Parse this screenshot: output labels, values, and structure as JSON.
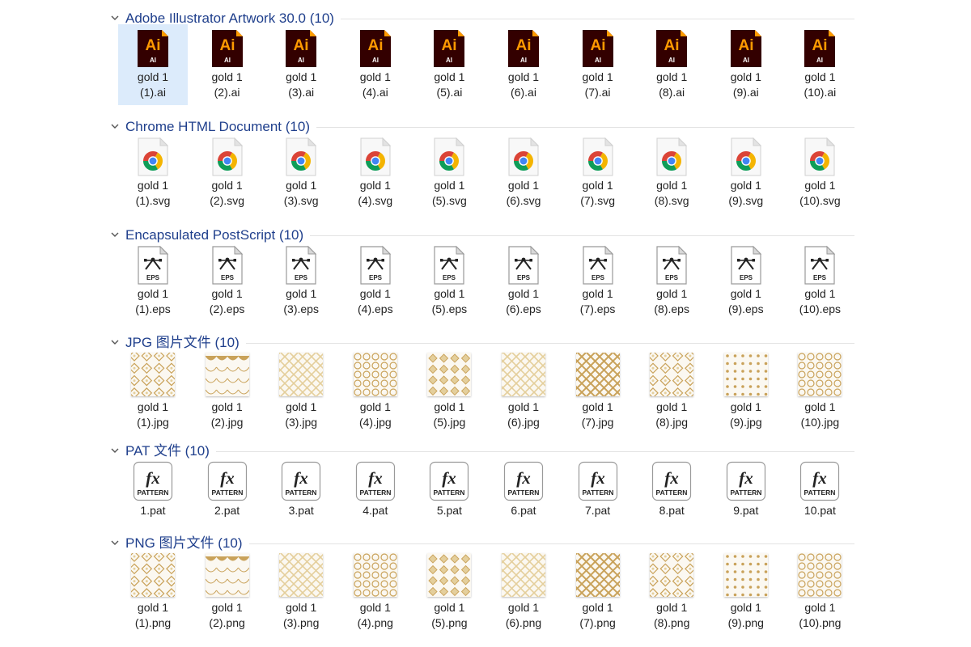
{
  "colors": {
    "group_title": "#1f3f8c",
    "selection": "#dcebfb",
    "ai_bg": "#330000",
    "ai_orange": "#ff9a00",
    "gold": "#c9a25a"
  },
  "groups": [
    {
      "id": "ai",
      "title": "Adobe Illustrator Artwork 30.0 (10)",
      "icon": "illustrator-file-icon",
      "items": [
        {
          "line1": "gold 1",
          "line2": "(1).ai",
          "selected": true
        },
        {
          "line1": "gold 1",
          "line2": "(2).ai"
        },
        {
          "line1": "gold 1",
          "line2": "(3).ai"
        },
        {
          "line1": "gold 1",
          "line2": "(4).ai"
        },
        {
          "line1": "gold 1",
          "line2": "(5).ai"
        },
        {
          "line1": "gold 1",
          "line2": "(6).ai"
        },
        {
          "line1": "gold 1",
          "line2": "(7).ai"
        },
        {
          "line1": "gold 1",
          "line2": "(8).ai"
        },
        {
          "line1": "gold 1",
          "line2": "(9).ai"
        },
        {
          "line1": "gold 1",
          "line2": "(10).ai"
        }
      ]
    },
    {
      "id": "svg",
      "title": "Chrome HTML Document (10)",
      "icon": "chrome-document-icon",
      "items": [
        {
          "line1": "gold 1",
          "line2": "(1).svg"
        },
        {
          "line1": "gold 1",
          "line2": "(2).svg"
        },
        {
          "line1": "gold 1",
          "line2": "(3).svg"
        },
        {
          "line1": "gold 1",
          "line2": "(4).svg"
        },
        {
          "line1": "gold 1",
          "line2": "(5).svg"
        },
        {
          "line1": "gold 1",
          "line2": "(6).svg"
        },
        {
          "line1": "gold 1",
          "line2": "(7).svg"
        },
        {
          "line1": "gold 1",
          "line2": "(8).svg"
        },
        {
          "line1": "gold 1",
          "line2": "(9).svg"
        },
        {
          "line1": "gold 1",
          "line2": "(10).svg"
        }
      ]
    },
    {
      "id": "eps",
      "title": "Encapsulated PostScript (10)",
      "icon": "eps-file-icon",
      "icon_label": "EPS",
      "items": [
        {
          "line1": "gold 1",
          "line2": "(1).eps"
        },
        {
          "line1": "gold 1",
          "line2": "(2).eps"
        },
        {
          "line1": "gold 1",
          "line2": "(3).eps"
        },
        {
          "line1": "gold 1",
          "line2": "(4).eps"
        },
        {
          "line1": "gold 1",
          "line2": "(5).eps"
        },
        {
          "line1": "gold 1",
          "line2": "(6).eps"
        },
        {
          "line1": "gold 1",
          "line2": "(7).eps"
        },
        {
          "line1": "gold 1",
          "line2": "(8).eps"
        },
        {
          "line1": "gold 1",
          "line2": "(9).eps"
        },
        {
          "line1": "gold 1",
          "line2": "(10).eps"
        }
      ]
    },
    {
      "id": "jpg",
      "title": "JPG 图片文件 (10)",
      "icon": "pattern-thumbnail",
      "items": [
        {
          "line1": "gold 1",
          "line2": "(1).jpg"
        },
        {
          "line1": "gold 1",
          "line2": "(2).jpg"
        },
        {
          "line1": "gold 1",
          "line2": "(3).jpg"
        },
        {
          "line1": "gold 1",
          "line2": "(4).jpg"
        },
        {
          "line1": "gold 1",
          "line2": "(5).jpg"
        },
        {
          "line1": "gold 1",
          "line2": "(6).jpg"
        },
        {
          "line1": "gold 1",
          "line2": "(7).jpg"
        },
        {
          "line1": "gold 1",
          "line2": "(8).jpg"
        },
        {
          "line1": "gold 1",
          "line2": "(9).jpg"
        },
        {
          "line1": "gold 1",
          "line2": "(10).jpg"
        }
      ]
    },
    {
      "id": "pat",
      "title": "PAT 文件 (10)",
      "icon": "pattern-file-icon",
      "icon_label": "PATTERN",
      "icon_glyph": "fx",
      "items": [
        {
          "line1": "1.pat"
        },
        {
          "line1": "2.pat"
        },
        {
          "line1": "3.pat"
        },
        {
          "line1": "4.pat"
        },
        {
          "line1": "5.pat"
        },
        {
          "line1": "6.pat"
        },
        {
          "line1": "7.pat"
        },
        {
          "line1": "8.pat"
        },
        {
          "line1": "9.pat"
        },
        {
          "line1": "10.pat"
        }
      ]
    },
    {
      "id": "png",
      "title": "PNG 图片文件 (10)",
      "icon": "pattern-thumbnail",
      "items": [
        {
          "line1": "gold 1",
          "line2": "(1).png"
        },
        {
          "line1": "gold 1",
          "line2": "(2).png"
        },
        {
          "line1": "gold 1",
          "line2": "(3).png"
        },
        {
          "line1": "gold 1",
          "line2": "(4).png"
        },
        {
          "line1": "gold 1",
          "line2": "(5).png"
        },
        {
          "line1": "gold 1",
          "line2": "(6).png"
        },
        {
          "line1": "gold 1",
          "line2": "(7).png"
        },
        {
          "line1": "gold 1",
          "line2": "(8).png"
        },
        {
          "line1": "gold 1",
          "line2": "(9).png"
        },
        {
          "line1": "gold 1",
          "line2": "(10).png"
        }
      ]
    }
  ],
  "ai_icon": {
    "glyph": "Ai",
    "caption": "AI"
  }
}
